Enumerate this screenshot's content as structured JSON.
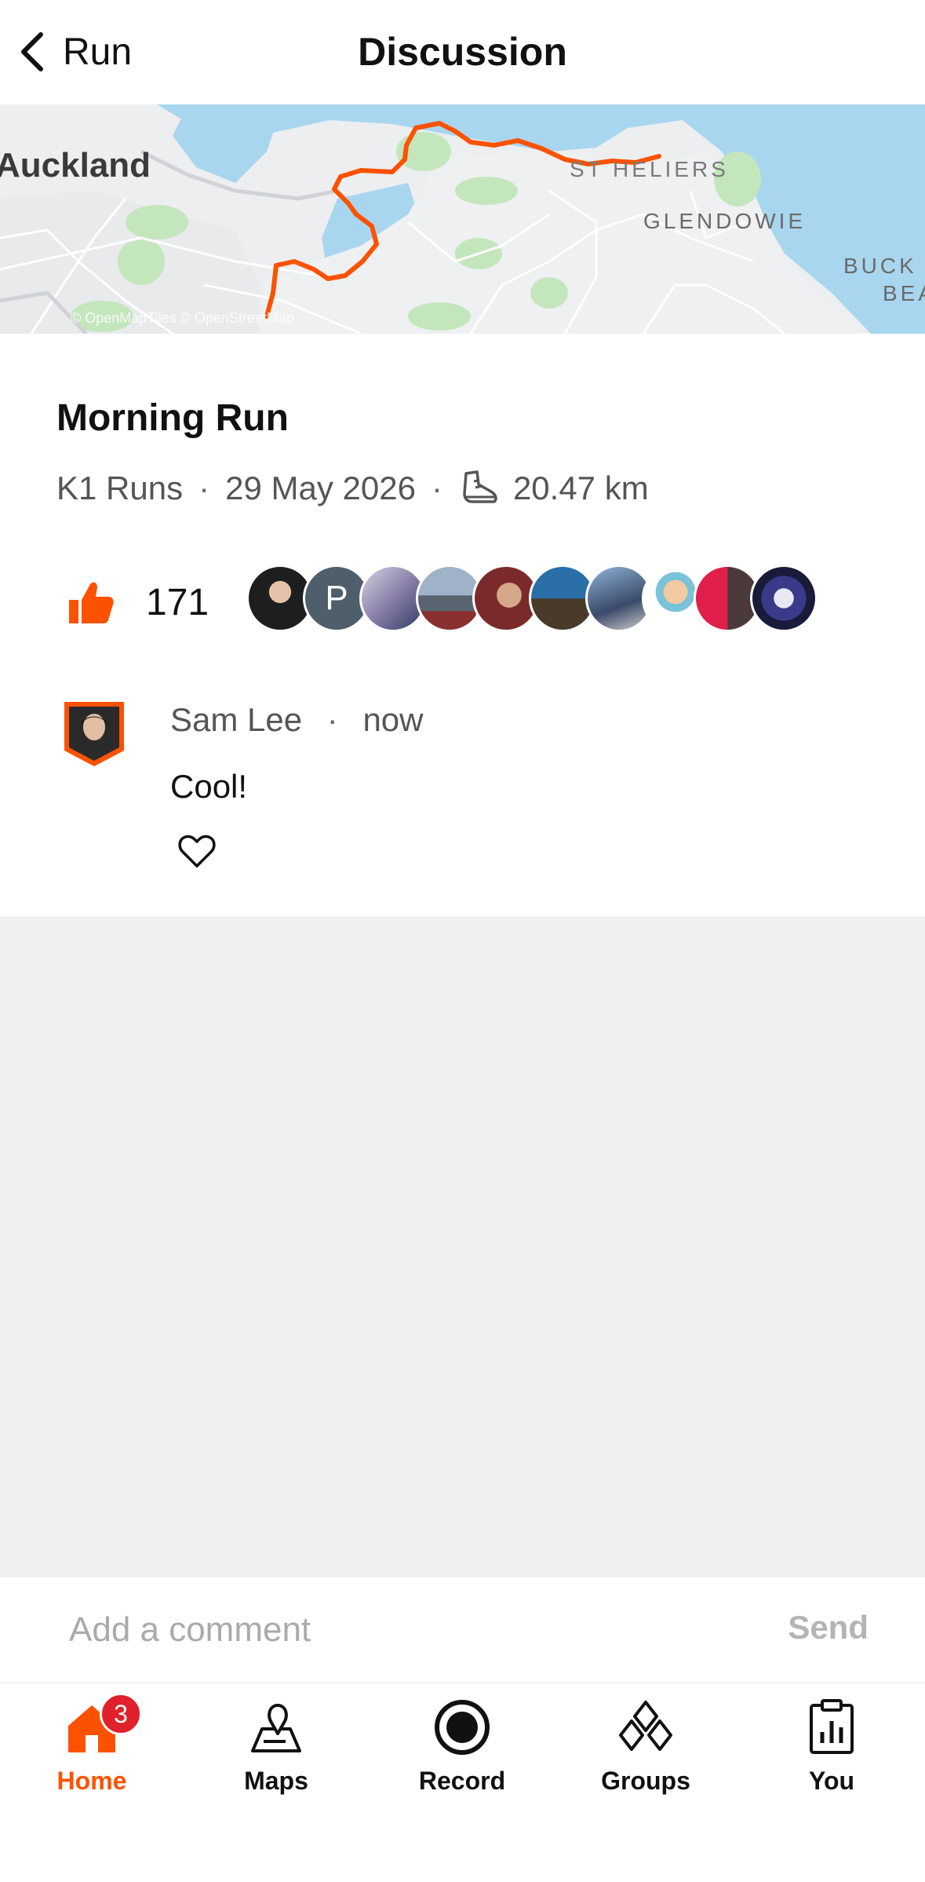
{
  "header": {
    "back_label": "Run",
    "title": "Discussion"
  },
  "map": {
    "labels": {
      "city": "Auckland",
      "suburb1": "ST HELIERS",
      "suburb2": "GLENDOWIE",
      "suburb3_line1": "BUCK",
      "suburb3_line2": "BEA",
      "attribution": "© OpenMapTiles © OpenStreetMap"
    },
    "route_color": "#fc5200"
  },
  "activity": {
    "name": "Morning Run",
    "club": "K1 Runs",
    "date": "29 May 2026",
    "distance": "20.47 km",
    "sport_icon": "running-shoe-icon"
  },
  "kudos": {
    "count": "171",
    "icon": "thumbs-up-icon",
    "avatar_letter": "P"
  },
  "comment": {
    "author": "Sam Lee",
    "time": "now",
    "text": "Cool!"
  },
  "comment_bar": {
    "placeholder": "Add a comment",
    "send_label": "Send"
  },
  "tabbar": {
    "home": "Home",
    "home_badge": "3",
    "maps": "Maps",
    "record": "Record",
    "groups": "Groups",
    "you": "You"
  },
  "colors": {
    "accent": "#fc5200",
    "badge": "#e0202a",
    "background_gray": "#f0f0ef"
  }
}
